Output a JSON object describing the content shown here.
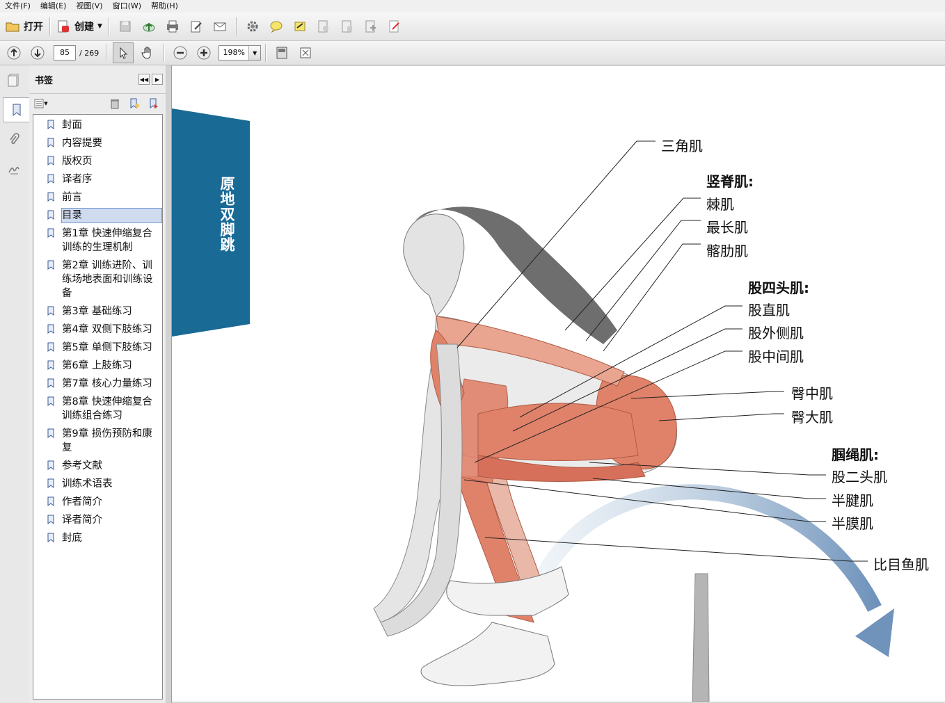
{
  "menu": [
    "文件(F)",
    "编辑(E)",
    "视图(V)",
    "窗口(W)",
    "帮助(H)"
  ],
  "toolbar": {
    "open_label": "打开",
    "create_label": "创建"
  },
  "nav": {
    "page_current": "85",
    "page_total": "/ 269",
    "zoom": "198%"
  },
  "bookmarks": {
    "title": "书签",
    "items": [
      {
        "label": "封面"
      },
      {
        "label": "内容提要"
      },
      {
        "label": "版权页"
      },
      {
        "label": "译者序"
      },
      {
        "label": "前言"
      },
      {
        "label": "目录"
      },
      {
        "label": "第1章 快速伸缩复合训练的生理机制"
      },
      {
        "label": "第2章 训练进阶、训练场地表面和训练设备"
      },
      {
        "label": "第3章 基础练习"
      },
      {
        "label": "第4章 双侧下肢练习"
      },
      {
        "label": "第5章 单侧下肢练习"
      },
      {
        "label": "第6章 上肢练习"
      },
      {
        "label": "第7章 核心力量练习"
      },
      {
        "label": "第8章 快速伸缩复合训练组合练习"
      },
      {
        "label": "第9章 损伤预防和康复"
      },
      {
        "label": "参考文献"
      },
      {
        "label": "训练术语表"
      },
      {
        "label": "作者简介"
      },
      {
        "label": "译者简介"
      },
      {
        "label": "封底"
      }
    ]
  },
  "page": {
    "tab_title": "原地双脚跳",
    "labels": {
      "deltoid": "三角肌",
      "erector": "竖脊肌:",
      "spinalis": "棘肌",
      "longissimus": "最长肌",
      "iliocostalis": "髂肋肌",
      "quadriceps": "股四头肌:",
      "rectus_femoris": "股直肌",
      "vastus_lateralis": "股外侧肌",
      "vastus_intermedius": "股中间肌",
      "gluteus_medius": "臀中肌",
      "gluteus_maximus": "臀大肌",
      "hamstrings": "腘绳肌:",
      "biceps_femoris": "股二头肌",
      "semitendinosus": "半腱肌",
      "semimembranosus": "半膜肌",
      "soleus": "比目鱼肌"
    }
  },
  "colors": {
    "tab_blue": "#1a6a96",
    "muscle": "#e0826a",
    "arrow": "#7a9cc0"
  }
}
